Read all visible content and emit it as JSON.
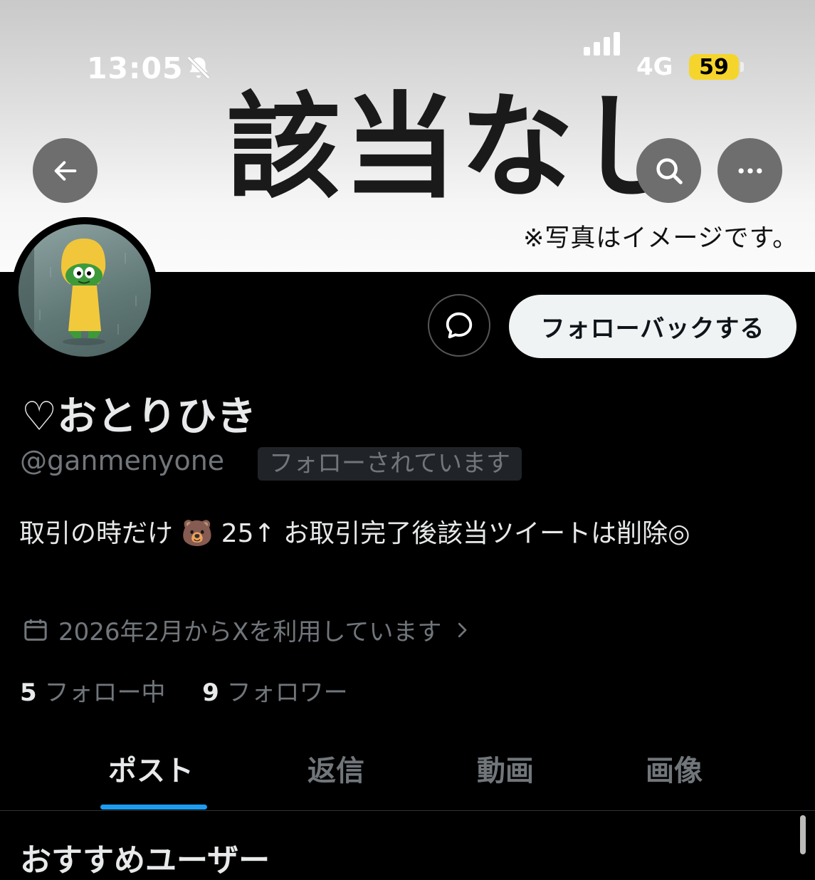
{
  "status_bar": {
    "time": "13:05",
    "network": "4G",
    "battery": "59"
  },
  "banner": {
    "title": "該当なし",
    "subtitle": "※写真はイメージです。"
  },
  "profile": {
    "display_name": "♡おとりひき",
    "handle": "@ganmenyone",
    "follows_you": "フォローされています",
    "follow_back_label": "フォローバックする",
    "bio": "取引の時だけ 🐻 25↑ お取引完了後該当ツイートは削除◎",
    "joined": "2026年2月からXを利用しています",
    "following_count": "5",
    "following_label": "フォロー中",
    "followers_count": "9",
    "followers_label": "フォロワー"
  },
  "tabs": [
    "ポスト",
    "返信",
    "動画",
    "画像"
  ],
  "active_tab": "ポスト",
  "section_title": "おすすめユーザー",
  "colors": {
    "accent": "#1d9bf0",
    "background": "#000000",
    "muted_text": "#71767b",
    "battery": "#f5d52b"
  },
  "icons": [
    "back-arrow-icon",
    "search-icon",
    "more-icon",
    "message-icon",
    "calendar-icon",
    "chevron-right-icon",
    "bell-slash-icon",
    "signal-icon"
  ]
}
